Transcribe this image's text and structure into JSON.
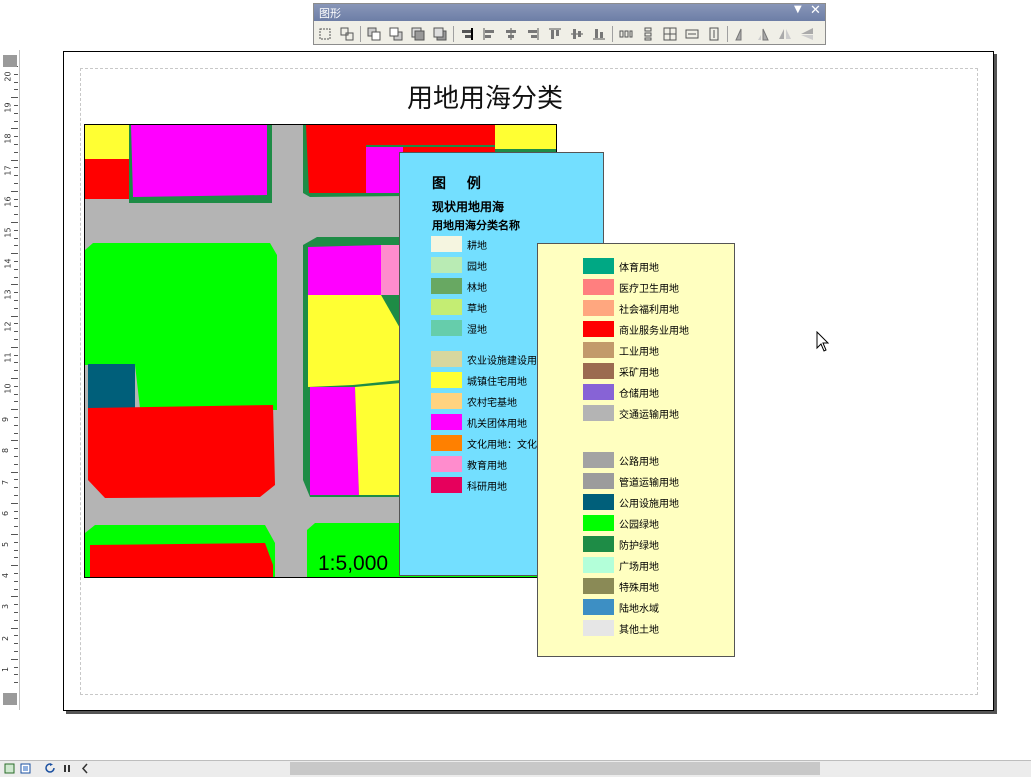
{
  "toolbar": {
    "title": "图形",
    "menu_glyph": "▼",
    "close_glyph": "✕"
  },
  "ruler": {
    "labels": [
      "20",
      "19",
      "18",
      "17",
      "16",
      "15",
      "14",
      "13",
      "12",
      "11",
      "10",
      "9",
      "8",
      "7",
      "6",
      "5",
      "4",
      "3",
      "2",
      "1"
    ]
  },
  "map": {
    "title": "用地用海分类",
    "scale": "1:5,000"
  },
  "legend1": {
    "title": "图 例",
    "subtitle1": "现状用地用海",
    "subtitle2": "用地用海分类名称",
    "items": [
      {
        "label": "耕地",
        "color": "#f5f5e0"
      },
      {
        "label": "园地",
        "color": "#b9ebb4"
      },
      {
        "label": "林地",
        "color": "#68a862"
      },
      {
        "label": "草地",
        "color": "#c4ed73"
      },
      {
        "label": "湿地",
        "color": "#66cdab"
      },
      {
        "label": "农业设施建设用地",
        "color": "#d7d79e"
      },
      {
        "label": "城镇住宅用地",
        "color": "#ffff33"
      },
      {
        "label": "农村宅基地",
        "color": "#ffd37f"
      },
      {
        "label": "机关团体用地",
        "color": "#ff00ff"
      },
      {
        "label": "文化用地：文化",
        "color": "#ff8000"
      },
      {
        "label": "教育用地",
        "color": "#ff8ccd"
      },
      {
        "label": "科研用地",
        "color": "#e6005c"
      }
    ]
  },
  "legend2": {
    "items": [
      {
        "label": "体育用地",
        "color": "#00a884"
      },
      {
        "label": "医疗卫生用地",
        "color": "#ff7f7f"
      },
      {
        "label": "社会福利用地",
        "color": "#ffa77f"
      },
      {
        "label": "商业服务业用地",
        "color": "#ff0000"
      },
      {
        "label": "工业用地",
        "color": "#c29a6b"
      },
      {
        "label": "采矿用地",
        "color": "#9b6b50"
      },
      {
        "label": "仓储用地",
        "color": "#8763d6"
      },
      {
        "label": "交通运输用地",
        "color": "#b4b4b4"
      },
      {
        "label": "公路用地",
        "color": "#a3a3a3"
      },
      {
        "label": "管道运输用地",
        "color": "#9c9c9c"
      },
      {
        "label": "公用设施用地",
        "color": "#005f7a"
      },
      {
        "label": "公园绿地",
        "color": "#00ff00"
      },
      {
        "label": "防护绿地",
        "color": "#1e8c46"
      },
      {
        "label": "广场用地",
        "color": "#b3ffd9"
      },
      {
        "label": "特殊用地",
        "color": "#8a8a56"
      },
      {
        "label": "陆地水域",
        "color": "#3d8fc4"
      },
      {
        "label": "其他土地",
        "color": "#e6e6e6"
      }
    ]
  }
}
